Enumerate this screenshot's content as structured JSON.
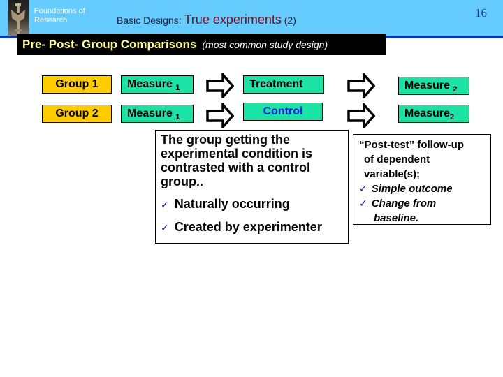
{
  "header": {
    "org_line1": "Foundations of",
    "org_line2": "Research",
    "title_prefix": "Basic Designs: ",
    "title_main": "True experiments",
    "title_suffix": " (2)",
    "page_number": "16",
    "logo": "statue-photo"
  },
  "subtitle": {
    "strong": "Pre- Post- Group Comparisons",
    "note": "(most common study design)"
  },
  "diagram": {
    "rows": [
      {
        "group": "Group 1",
        "measure_pre": "Measure",
        "measure_pre_sub": "1",
        "condition": "Treatment",
        "measure_post": "Measure ",
        "measure_post_sub": "2"
      },
      {
        "group": "Group 2",
        "measure_pre": "Measure",
        "measure_pre_sub": "1",
        "condition": "Control",
        "measure_post": "Measure",
        "measure_post_sub": "2"
      }
    ],
    "arrow_icon": "right-arrow-outline"
  },
  "panels": {
    "left": {
      "lead": "The group getting the experimental condition is contrasted with a control group..",
      "bullets": [
        "Naturally occurring",
        "Created by experimenter"
      ]
    },
    "right": {
      "line1": "“Post-test” follow-up",
      "line2": "of dependent",
      "line3": "variable(s);",
      "bullets": [
        "Simple outcome",
        "Change from",
        "baseline."
      ]
    },
    "check_glyph": "✓"
  },
  "colors": {
    "header_band": "#66ccff",
    "header_rule": "#0a33c2",
    "group_box": "#ffcc00",
    "measure_box": "#1de2a6",
    "subtitle_text": "#ffff99",
    "control_text": "#1a1ae6",
    "title_emphasis": "#6a0a1e"
  }
}
